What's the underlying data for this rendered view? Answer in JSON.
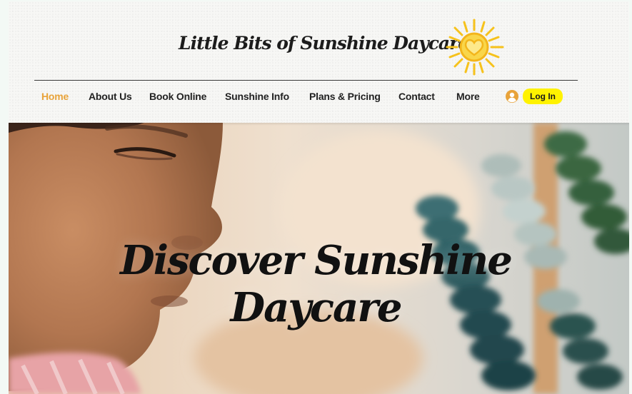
{
  "header": {
    "site_title": "Little Bits of Sunshine Daycare",
    "logo_icon": "sun-heart-icon"
  },
  "nav": {
    "items": [
      {
        "label": "Home",
        "active": true
      },
      {
        "label": "About Us",
        "active": false
      },
      {
        "label": "Book Online",
        "active": false
      },
      {
        "label": "Sunshine Info",
        "active": false
      },
      {
        "label": "Plans & Pricing",
        "active": false
      },
      {
        "label": "Contact",
        "active": false
      },
      {
        "label": "More",
        "active": false
      }
    ],
    "login_label": "Log In",
    "login_icon": "user-avatar-icon"
  },
  "hero": {
    "title": "Discover Sunshine Daycare",
    "image": "child-with-abacus-photo"
  },
  "colors": {
    "accent": "#e8a33a",
    "login_highlight": "#fff200",
    "sun": "#f6c21c",
    "text": "#222222"
  }
}
